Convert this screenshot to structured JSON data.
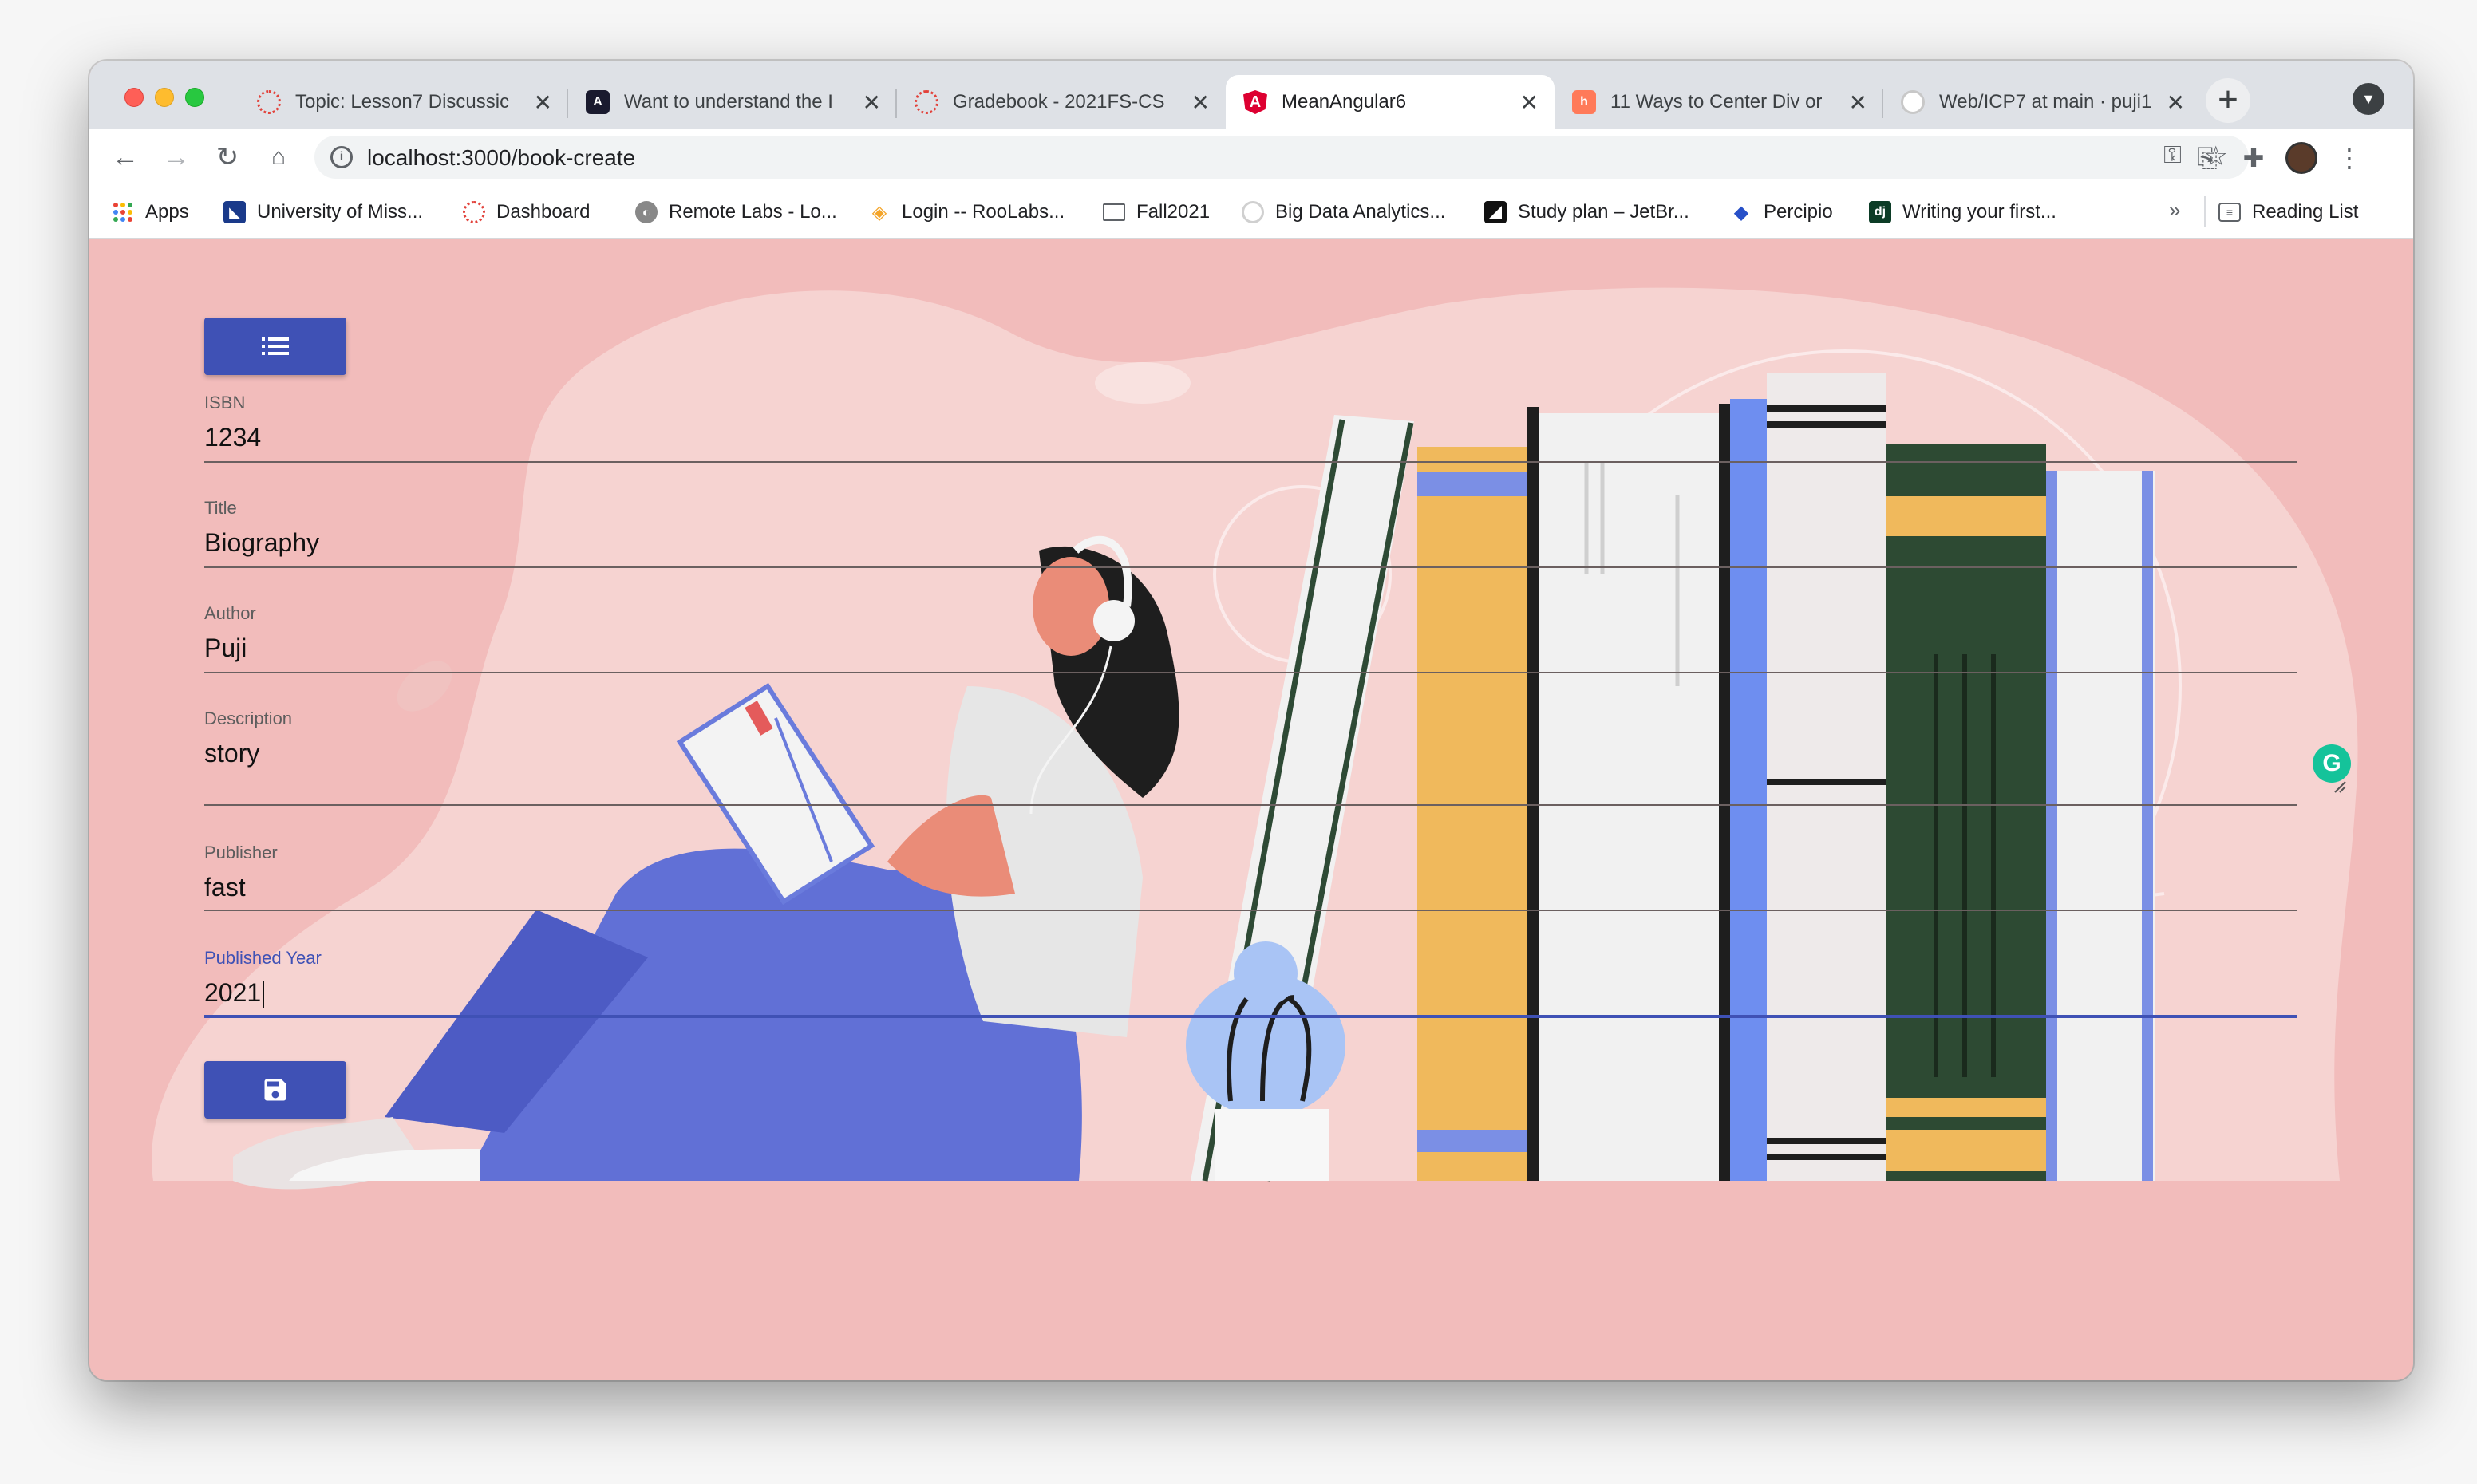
{
  "browser": {
    "tabs": [
      {
        "title": "Topic: Lesson7 Discussic",
        "icon": "canvas-icon",
        "active": false
      },
      {
        "title": "Want to understand the I",
        "icon": "angular-dark-icon",
        "active": false
      },
      {
        "title": "Gradebook - 2021FS-CS",
        "icon": "canvas-icon",
        "active": false
      },
      {
        "title": "MeanAngular6",
        "icon": "angular-icon",
        "active": true
      },
      {
        "title": "11 Ways to Center Div or",
        "icon": "hubspot-icon",
        "active": false
      },
      {
        "title": "Web/ICP7 at main · puji1",
        "icon": "github-icon",
        "active": false
      }
    ],
    "address": {
      "url": "localhost:3000/book-create"
    },
    "bookmarks": [
      {
        "label": "Apps",
        "icon": "apps-grid-icon"
      },
      {
        "label": "University of Miss...",
        "icon": "umkc-icon"
      },
      {
        "label": "Dashboard",
        "icon": "canvas-icon"
      },
      {
        "label": "Remote Labs - Lo...",
        "icon": "globe-icon"
      },
      {
        "label": "Login -- RooLabs...",
        "icon": "roolabs-icon"
      },
      {
        "label": "Fall2021",
        "icon": "folder-icon"
      },
      {
        "label": "Big Data Analytics...",
        "icon": "github-icon"
      },
      {
        "label": "Study plan – JetBr...",
        "icon": "jetbrains-icon"
      },
      {
        "label": "Percipio",
        "icon": "percipio-icon"
      },
      {
        "label": "Writing your first...",
        "icon": "django-icon"
      }
    ],
    "bookmarks_overflow": "»",
    "reading_list": "Reading List"
  },
  "form": {
    "fields": [
      {
        "label": "ISBN",
        "value": "1234"
      },
      {
        "label": "Title",
        "value": "Biography"
      },
      {
        "label": "Author",
        "value": "Puji"
      },
      {
        "label": "Description",
        "value": "story"
      },
      {
        "label": "Publisher",
        "value": "fast"
      },
      {
        "label": "Published Year",
        "value": "2021"
      }
    ],
    "menu_icon": "list-icon",
    "save_icon": "save-icon"
  },
  "colors": {
    "primary": "#3f51b5",
    "page_bg": "#f2bcbb",
    "grammarly": "#15c39a"
  }
}
